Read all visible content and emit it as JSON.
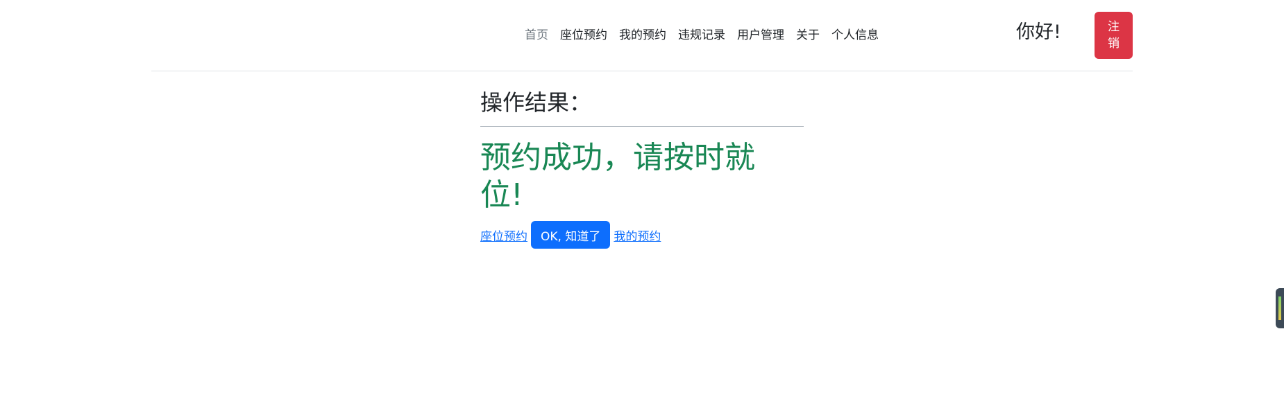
{
  "nav": {
    "items": [
      {
        "label": "首页",
        "active": true
      },
      {
        "label": "座位预约",
        "active": false
      },
      {
        "label": "我的预约",
        "active": false
      },
      {
        "label": "违规记录",
        "active": false
      },
      {
        "label": "用户管理",
        "active": false
      },
      {
        "label": "关于",
        "active": false
      },
      {
        "label": "个人信息",
        "active": false
      }
    ]
  },
  "header": {
    "greeting": "你好!",
    "logout_label": "注销"
  },
  "result": {
    "title": "操作结果：",
    "message": "预约成功，请按时就位!",
    "actions": {
      "seat_reservation_link": "座位预约",
      "ok_button": "OK, 知道了",
      "my_reservations_link": "我的预约"
    }
  },
  "colors": {
    "success": "#198754",
    "primary": "#0d6efd",
    "danger": "#dc3545",
    "muted": "#6c757d"
  }
}
